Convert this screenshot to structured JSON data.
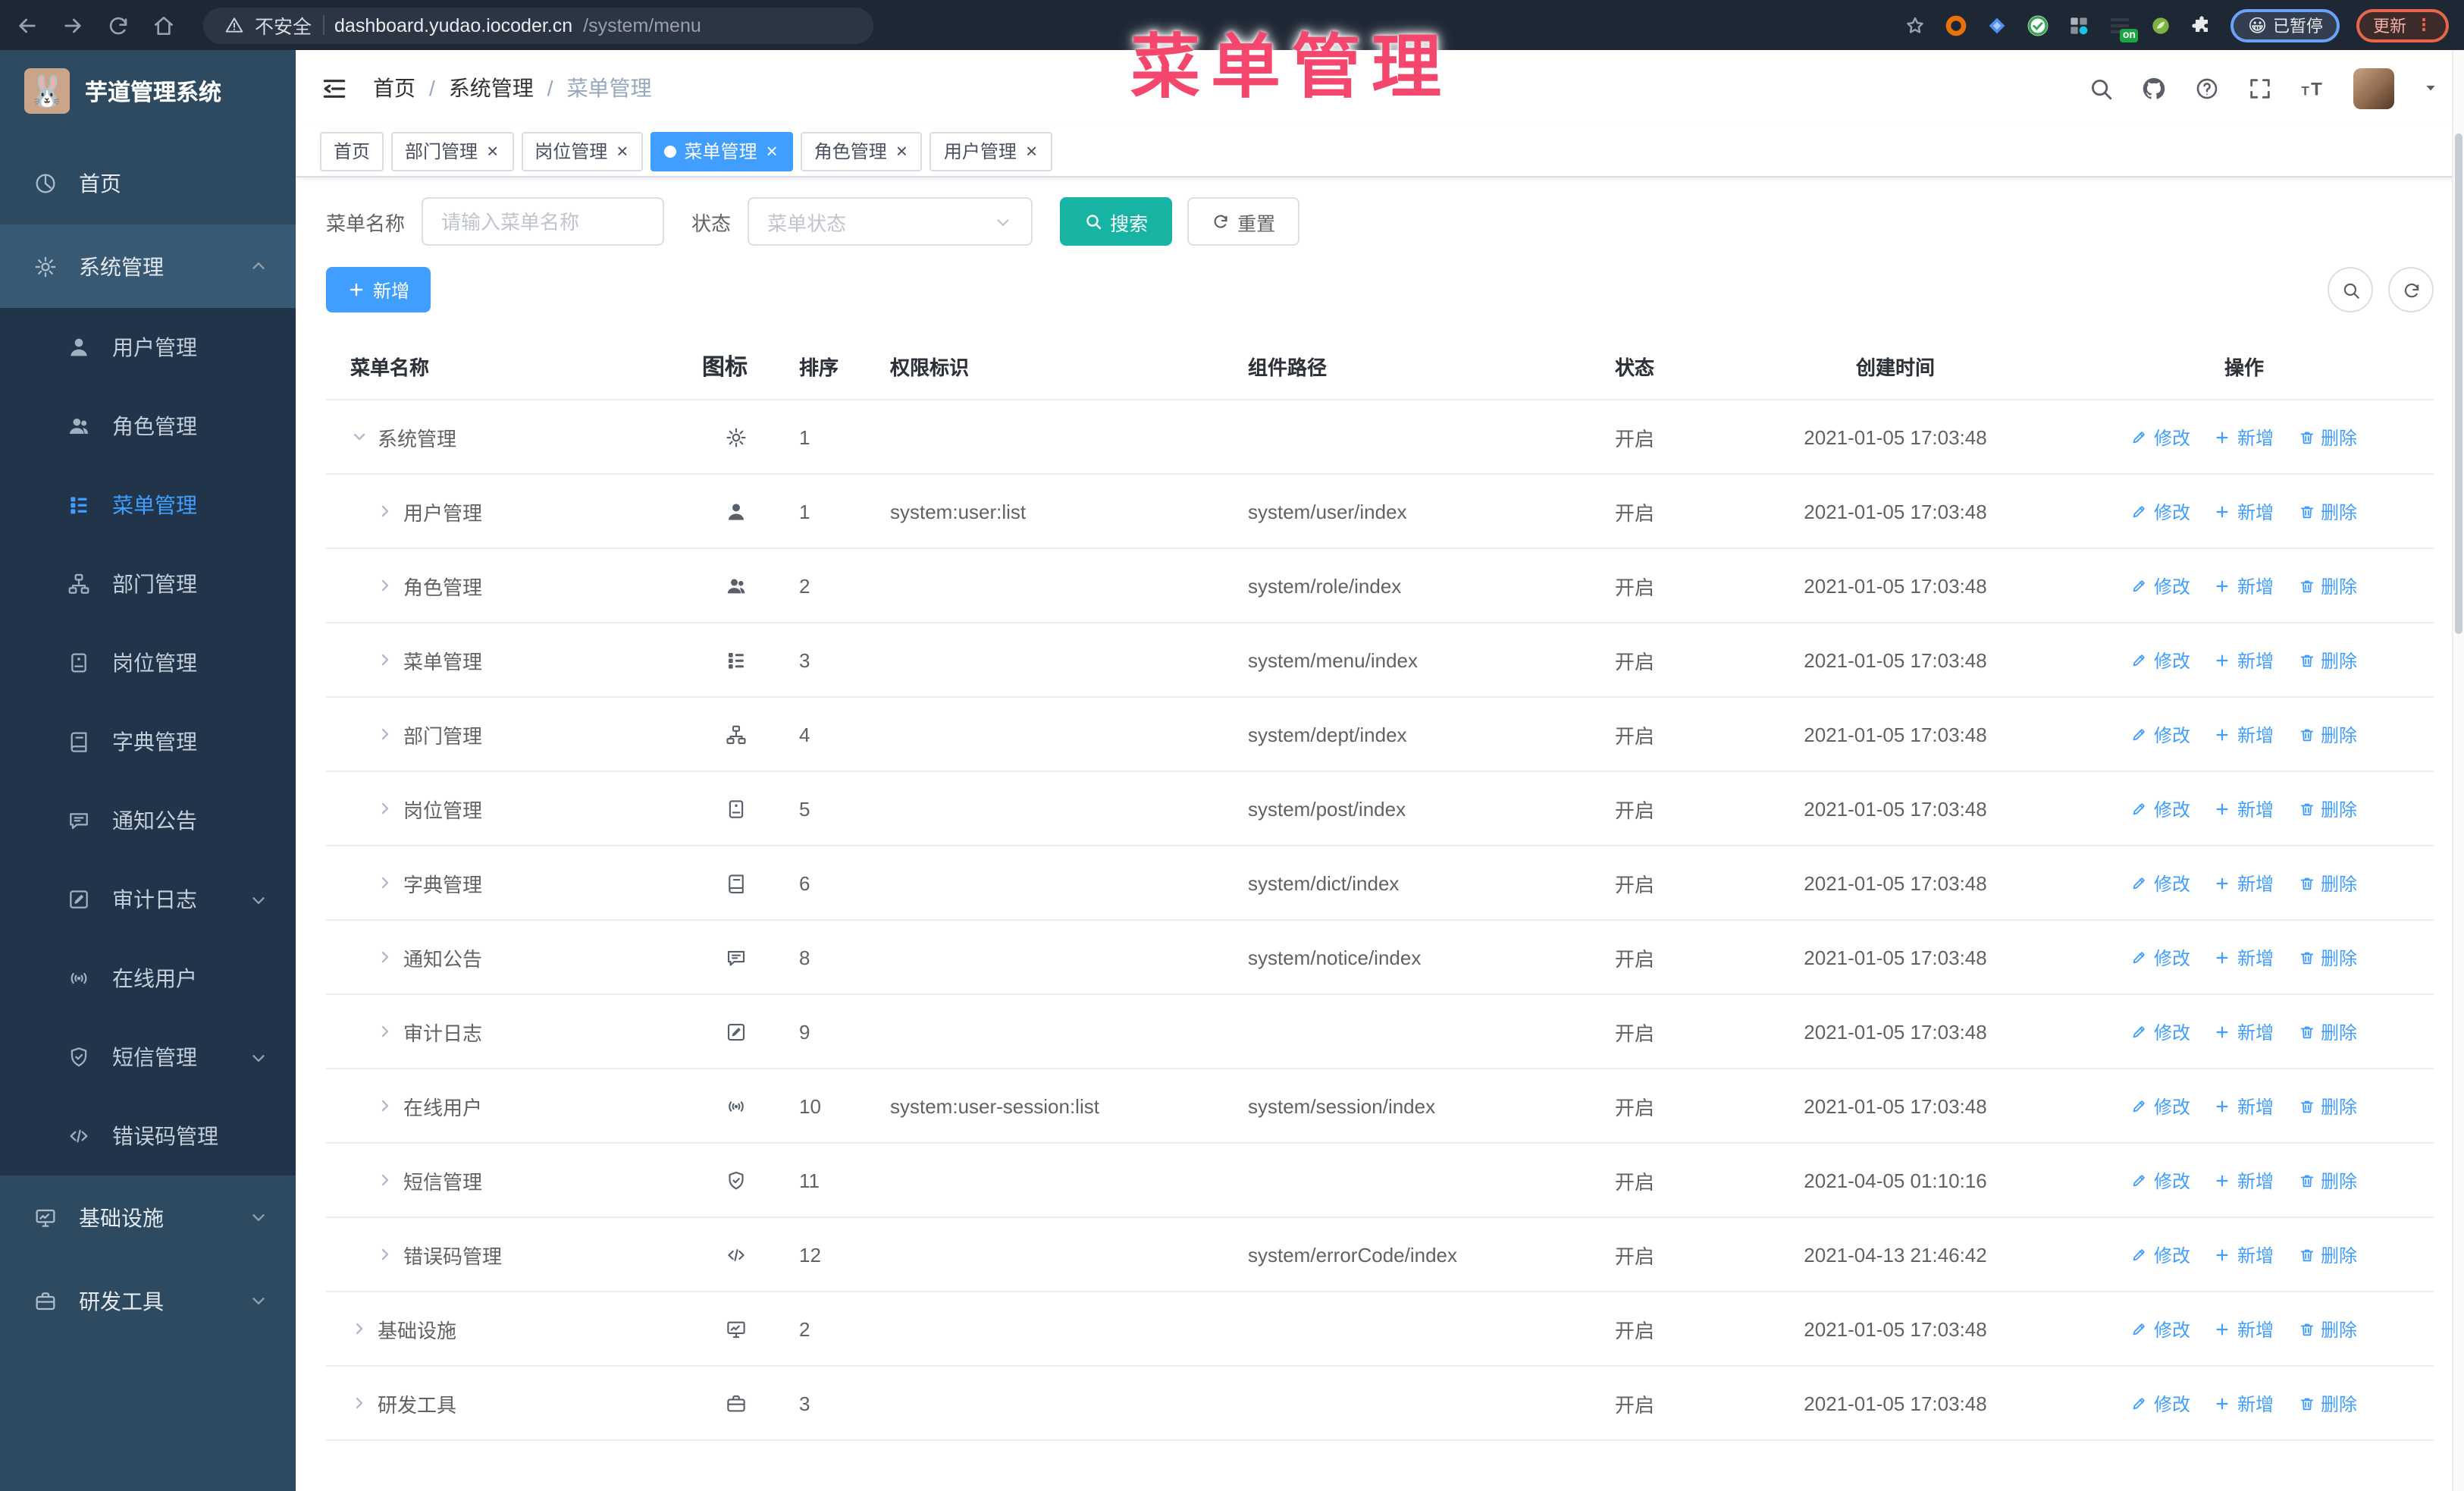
{
  "overlay_title": "菜单管理",
  "browser": {
    "security_label": "不安全",
    "url_domain": "dashboard.yudao.iocoder.cn",
    "url_path": "/system/menu",
    "on_badge": "on",
    "paused_badge": "已暂停",
    "update_button": "更新"
  },
  "app": {
    "title": "芋道管理系统",
    "breadcrumb": [
      "首页",
      "系统管理",
      "菜单管理"
    ]
  },
  "sidebar": {
    "items": [
      {
        "label": "首页",
        "icon": "dashboard-icon",
        "type": "top"
      },
      {
        "label": "系统管理",
        "icon": "gear-icon",
        "type": "top",
        "expanded": true,
        "active": true
      },
      {
        "label": "用户管理",
        "icon": "user-icon",
        "type": "sub"
      },
      {
        "label": "角色管理",
        "icon": "users-icon",
        "type": "sub"
      },
      {
        "label": "菜单管理",
        "icon": "menu-tree-icon",
        "type": "sub",
        "active": true
      },
      {
        "label": "部门管理",
        "icon": "org-tree-icon",
        "type": "sub"
      },
      {
        "label": "岗位管理",
        "icon": "badge-icon",
        "type": "sub"
      },
      {
        "label": "字典管理",
        "icon": "dict-icon",
        "type": "sub"
      },
      {
        "label": "通知公告",
        "icon": "announcement-icon",
        "type": "sub"
      },
      {
        "label": "审计日志",
        "icon": "audit-log-icon",
        "type": "sub",
        "chevron": "down"
      },
      {
        "label": "在线用户",
        "icon": "online-user-icon",
        "type": "sub"
      },
      {
        "label": "短信管理",
        "icon": "sms-icon",
        "type": "sub",
        "chevron": "down"
      },
      {
        "label": "错误码管理",
        "icon": "error-code-icon",
        "type": "sub"
      },
      {
        "label": "基础设施",
        "icon": "infrastructure-icon",
        "type": "top",
        "chevron": "down"
      },
      {
        "label": "研发工具",
        "icon": "devtools-icon",
        "type": "top",
        "chevron": "down"
      }
    ]
  },
  "tabs": [
    {
      "label": "首页",
      "closable": false,
      "active": false
    },
    {
      "label": "部门管理",
      "closable": true,
      "active": false
    },
    {
      "label": "岗位管理",
      "closable": true,
      "active": false
    },
    {
      "label": "菜单管理",
      "closable": true,
      "active": true
    },
    {
      "label": "角色管理",
      "closable": true,
      "active": false
    },
    {
      "label": "用户管理",
      "closable": true,
      "active": false
    }
  ],
  "filters": {
    "name_label": "菜单名称",
    "name_placeholder": "请输入菜单名称",
    "status_label": "状态",
    "status_placeholder": "菜单状态",
    "search_button": "搜索",
    "reset_button": "重置"
  },
  "toolbar": {
    "add_button": "新增"
  },
  "table": {
    "columns": [
      "菜单名称",
      "图标",
      "排序",
      "权限标识",
      "组件路径",
      "状态",
      "创建时间",
      "操作"
    ],
    "ops": {
      "edit": "修改",
      "add": "新增",
      "delete": "删除"
    },
    "rows": [
      {
        "name": "系统管理",
        "level": 0,
        "caret": "down",
        "icon": "gear-icon",
        "sort": "1",
        "perm": "",
        "path": "",
        "status": "开启",
        "time": "2021-01-05 17:03:48"
      },
      {
        "name": "用户管理",
        "level": 1,
        "caret": "right",
        "icon": "user-icon",
        "sort": "1",
        "perm": "system:user:list",
        "path": "system/user/index",
        "status": "开启",
        "time": "2021-01-05 17:03:48"
      },
      {
        "name": "角色管理",
        "level": 1,
        "caret": "right",
        "icon": "users-icon",
        "sort": "2",
        "perm": "",
        "path": "system/role/index",
        "status": "开启",
        "time": "2021-01-05 17:03:48"
      },
      {
        "name": "菜单管理",
        "level": 1,
        "caret": "right",
        "icon": "menu-tree-icon",
        "sort": "3",
        "perm": "",
        "path": "system/menu/index",
        "status": "开启",
        "time": "2021-01-05 17:03:48"
      },
      {
        "name": "部门管理",
        "level": 1,
        "caret": "right",
        "icon": "org-tree-icon",
        "sort": "4",
        "perm": "",
        "path": "system/dept/index",
        "status": "开启",
        "time": "2021-01-05 17:03:48"
      },
      {
        "name": "岗位管理",
        "level": 1,
        "caret": "right",
        "icon": "badge-icon",
        "sort": "5",
        "perm": "",
        "path": "system/post/index",
        "status": "开启",
        "time": "2021-01-05 17:03:48"
      },
      {
        "name": "字典管理",
        "level": 1,
        "caret": "right",
        "icon": "dict-icon",
        "sort": "6",
        "perm": "",
        "path": "system/dict/index",
        "status": "开启",
        "time": "2021-01-05 17:03:48"
      },
      {
        "name": "通知公告",
        "level": 1,
        "caret": "right",
        "icon": "announcement-icon",
        "sort": "8",
        "perm": "",
        "path": "system/notice/index",
        "status": "开启",
        "time": "2021-01-05 17:03:48"
      },
      {
        "name": "审计日志",
        "level": 1,
        "caret": "right",
        "icon": "audit-log-icon",
        "sort": "9",
        "perm": "",
        "path": "",
        "status": "开启",
        "time": "2021-01-05 17:03:48"
      },
      {
        "name": "在线用户",
        "level": 1,
        "caret": "right",
        "icon": "online-user-icon",
        "sort": "10",
        "perm": "system:user-session:list",
        "path": "system/session/index",
        "status": "开启",
        "time": "2021-01-05 17:03:48"
      },
      {
        "name": "短信管理",
        "level": 1,
        "caret": "right",
        "icon": "sms-icon",
        "sort": "11",
        "perm": "",
        "path": "",
        "status": "开启",
        "time": "2021-04-05 01:10:16"
      },
      {
        "name": "错误码管理",
        "level": 1,
        "caret": "right",
        "icon": "error-code-icon",
        "sort": "12",
        "perm": "",
        "path": "system/errorCode/index",
        "status": "开启",
        "time": "2021-04-13 21:46:42"
      },
      {
        "name": "基础设施",
        "level": 0,
        "caret": "right",
        "icon": "infrastructure-icon",
        "sort": "2",
        "perm": "",
        "path": "",
        "status": "开启",
        "time": "2021-01-05 17:03:48"
      },
      {
        "name": "研发工具",
        "level": 0,
        "caret": "right",
        "icon": "devtools-icon",
        "sort": "3",
        "perm": "",
        "path": "",
        "status": "开启",
        "time": "2021-01-05 17:03:48"
      }
    ]
  }
}
